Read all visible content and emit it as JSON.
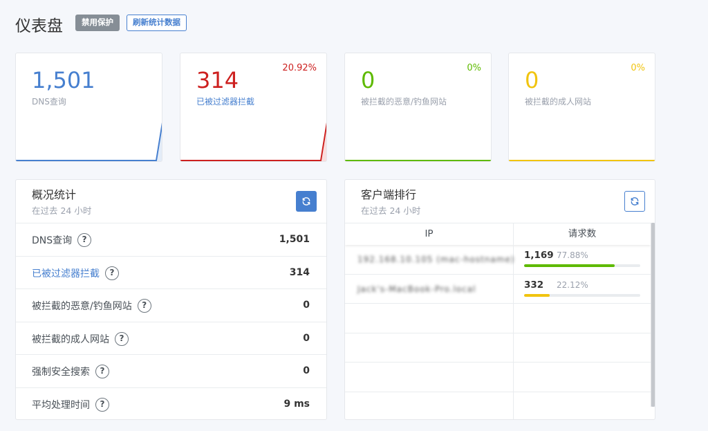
{
  "header": {
    "title": "仪表盘",
    "disable_protection_label": "禁用保护",
    "refresh_stats_label": "刷新统计数据"
  },
  "stat_cards": [
    {
      "value": "1,501",
      "label": "DNS查询",
      "percent": "",
      "color": "#467fcf"
    },
    {
      "value": "314",
      "label": "已被过滤器拦截",
      "percent": "20.92%",
      "color": "#cd201f"
    },
    {
      "value": "0",
      "label": "被拦截的恶意/钓鱼网站",
      "percent": "0%",
      "color": "#5eba00"
    },
    {
      "value": "0",
      "label": "被拦截的成人网站",
      "percent": "0%",
      "color": "#f1c40f"
    }
  ],
  "overview": {
    "title": "概况统计",
    "subtitle": "在过去 24 小时",
    "refresh_icon": "refresh-icon",
    "rows": [
      {
        "label": "DNS查询",
        "value": "1,501",
        "help": "?"
      },
      {
        "label": "已被过滤器拦截",
        "value": "314",
        "help": "?"
      },
      {
        "label": "被拦截的恶意/钓鱼网站",
        "value": "0",
        "help": "?"
      },
      {
        "label": "被拦截的成人网站",
        "value": "0",
        "help": "?"
      },
      {
        "label": "强制安全搜索",
        "value": "0",
        "help": "?"
      },
      {
        "label": "平均处理时间",
        "value": "9 ms",
        "help": "?"
      }
    ]
  },
  "clients": {
    "title": "客户端排行",
    "subtitle": "在过去 24 小时",
    "refresh_icon": "refresh-icon",
    "columns": [
      "IP",
      "请求数"
    ],
    "rows": [
      {
        "ip": "192.168.10.105 (mac-hostname)",
        "count": "1,169",
        "percent": "77.88%",
        "fraction": 0.7788,
        "bar_color": "#5eba00"
      },
      {
        "ip": "Jack's-MacBook-Pro.local",
        "count": "332",
        "percent": "22.12%",
        "fraction": 0.2212,
        "bar_color": "#f1c40f"
      }
    ]
  }
}
